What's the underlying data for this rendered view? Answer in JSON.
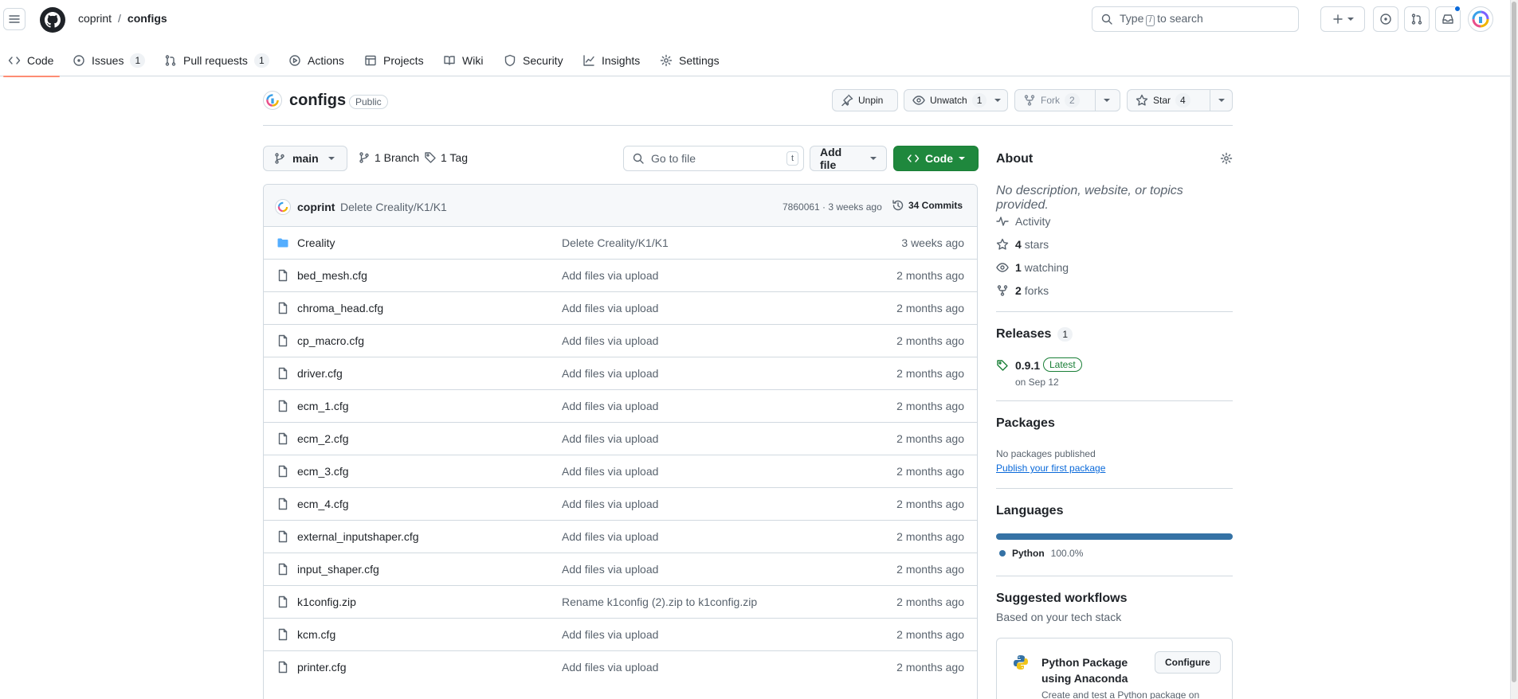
{
  "header": {
    "owner": "coprint",
    "separator": "/",
    "repo": "configs",
    "search": {
      "prefix": "Type",
      "key": "/",
      "suffix": "to search"
    }
  },
  "tabs": [
    {
      "label": "Code",
      "icon": "code-icon",
      "count": null
    },
    {
      "label": "Issues",
      "icon": "issue-icon",
      "count": "1"
    },
    {
      "label": "Pull requests",
      "icon": "pull-request-icon",
      "count": "1"
    },
    {
      "label": "Actions",
      "icon": "play-icon",
      "count": null
    },
    {
      "label": "Projects",
      "icon": "table-icon",
      "count": null
    },
    {
      "label": "Wiki",
      "icon": "book-icon",
      "count": null
    },
    {
      "label": "Security",
      "icon": "shield-icon",
      "count": null
    },
    {
      "label": "Insights",
      "icon": "graph-icon",
      "count": null
    },
    {
      "label": "Settings",
      "icon": "gear-icon",
      "count": null
    }
  ],
  "repo": {
    "name": "configs",
    "visibility": "Public",
    "unpin": "Unpin",
    "unwatch": "Unwatch",
    "watch_count": "1",
    "fork": "Fork",
    "fork_count": "2",
    "star": "Star",
    "star_count": "4"
  },
  "toolbar": {
    "branch": "main",
    "branches": "1 Branch",
    "tags": "1 Tag",
    "goto_placeholder": "Go to file",
    "goto_key": "t",
    "add_file": "Add file",
    "code": "Code"
  },
  "commit": {
    "author": "coprint",
    "message": "Delete Creality/K1/K1",
    "sha_time": "7860061 · 3 weeks ago",
    "commits": "34 Commits"
  },
  "files": [
    {
      "name": "Creality",
      "type": "folder",
      "message": "Delete Creality/K1/K1",
      "age": "3 weeks ago"
    },
    {
      "name": "bed_mesh.cfg",
      "type": "file",
      "message": "Add files via upload",
      "age": "2 months ago"
    },
    {
      "name": "chroma_head.cfg",
      "type": "file",
      "message": "Add files via upload",
      "age": "2 months ago"
    },
    {
      "name": "cp_macro.cfg",
      "type": "file",
      "message": "Add files via upload",
      "age": "2 months ago"
    },
    {
      "name": "driver.cfg",
      "type": "file",
      "message": "Add files via upload",
      "age": "2 months ago"
    },
    {
      "name": "ecm_1.cfg",
      "type": "file",
      "message": "Add files via upload",
      "age": "2 months ago"
    },
    {
      "name": "ecm_2.cfg",
      "type": "file",
      "message": "Add files via upload",
      "age": "2 months ago"
    },
    {
      "name": "ecm_3.cfg",
      "type": "file",
      "message": "Add files via upload",
      "age": "2 months ago"
    },
    {
      "name": "ecm_4.cfg",
      "type": "file",
      "message": "Add files via upload",
      "age": "2 months ago"
    },
    {
      "name": "external_inputshaper.cfg",
      "type": "file",
      "message": "Add files via upload",
      "age": "2 months ago"
    },
    {
      "name": "input_shaper.cfg",
      "type": "file",
      "message": "Add files via upload",
      "age": "2 months ago"
    },
    {
      "name": "k1config.zip",
      "type": "file",
      "message": "Rename k1config (2).zip to k1config.zip",
      "age": "2 months ago"
    },
    {
      "name": "kcm.cfg",
      "type": "file",
      "message": "Add files via upload",
      "age": "2 months ago"
    },
    {
      "name": "printer.cfg",
      "type": "file",
      "message": "Add files via upload",
      "age": "2 months ago"
    }
  ],
  "about": {
    "title": "About",
    "description": "No description, website, or topics provided.",
    "activity": "Activity",
    "stars_num": "4",
    "stars_label": "stars",
    "watching_num": "1",
    "watching_label": "watching",
    "forks_num": "2",
    "forks_label": "forks"
  },
  "releases": {
    "title": "Releases",
    "count": "1",
    "tag": "0.9.1",
    "badge": "Latest",
    "date": "on Sep 12"
  },
  "packages": {
    "title": "Packages",
    "none": "No packages published",
    "link": "Publish your first package"
  },
  "languages": {
    "title": "Languages",
    "items": [
      {
        "name": "Python",
        "percent": "100.0%",
        "color": "#3572a5"
      }
    ]
  },
  "workflows": {
    "title": "Suggested workflows",
    "subtitle": "Based on your tech stack",
    "card_name": "Python Package using Anaconda",
    "card_desc": "Create and test a Python package on",
    "configure": "Configure"
  },
  "colors": {
    "accent": "#0969da",
    "primary_button": "#1f883d",
    "tab_underline": "#fd8c73"
  }
}
